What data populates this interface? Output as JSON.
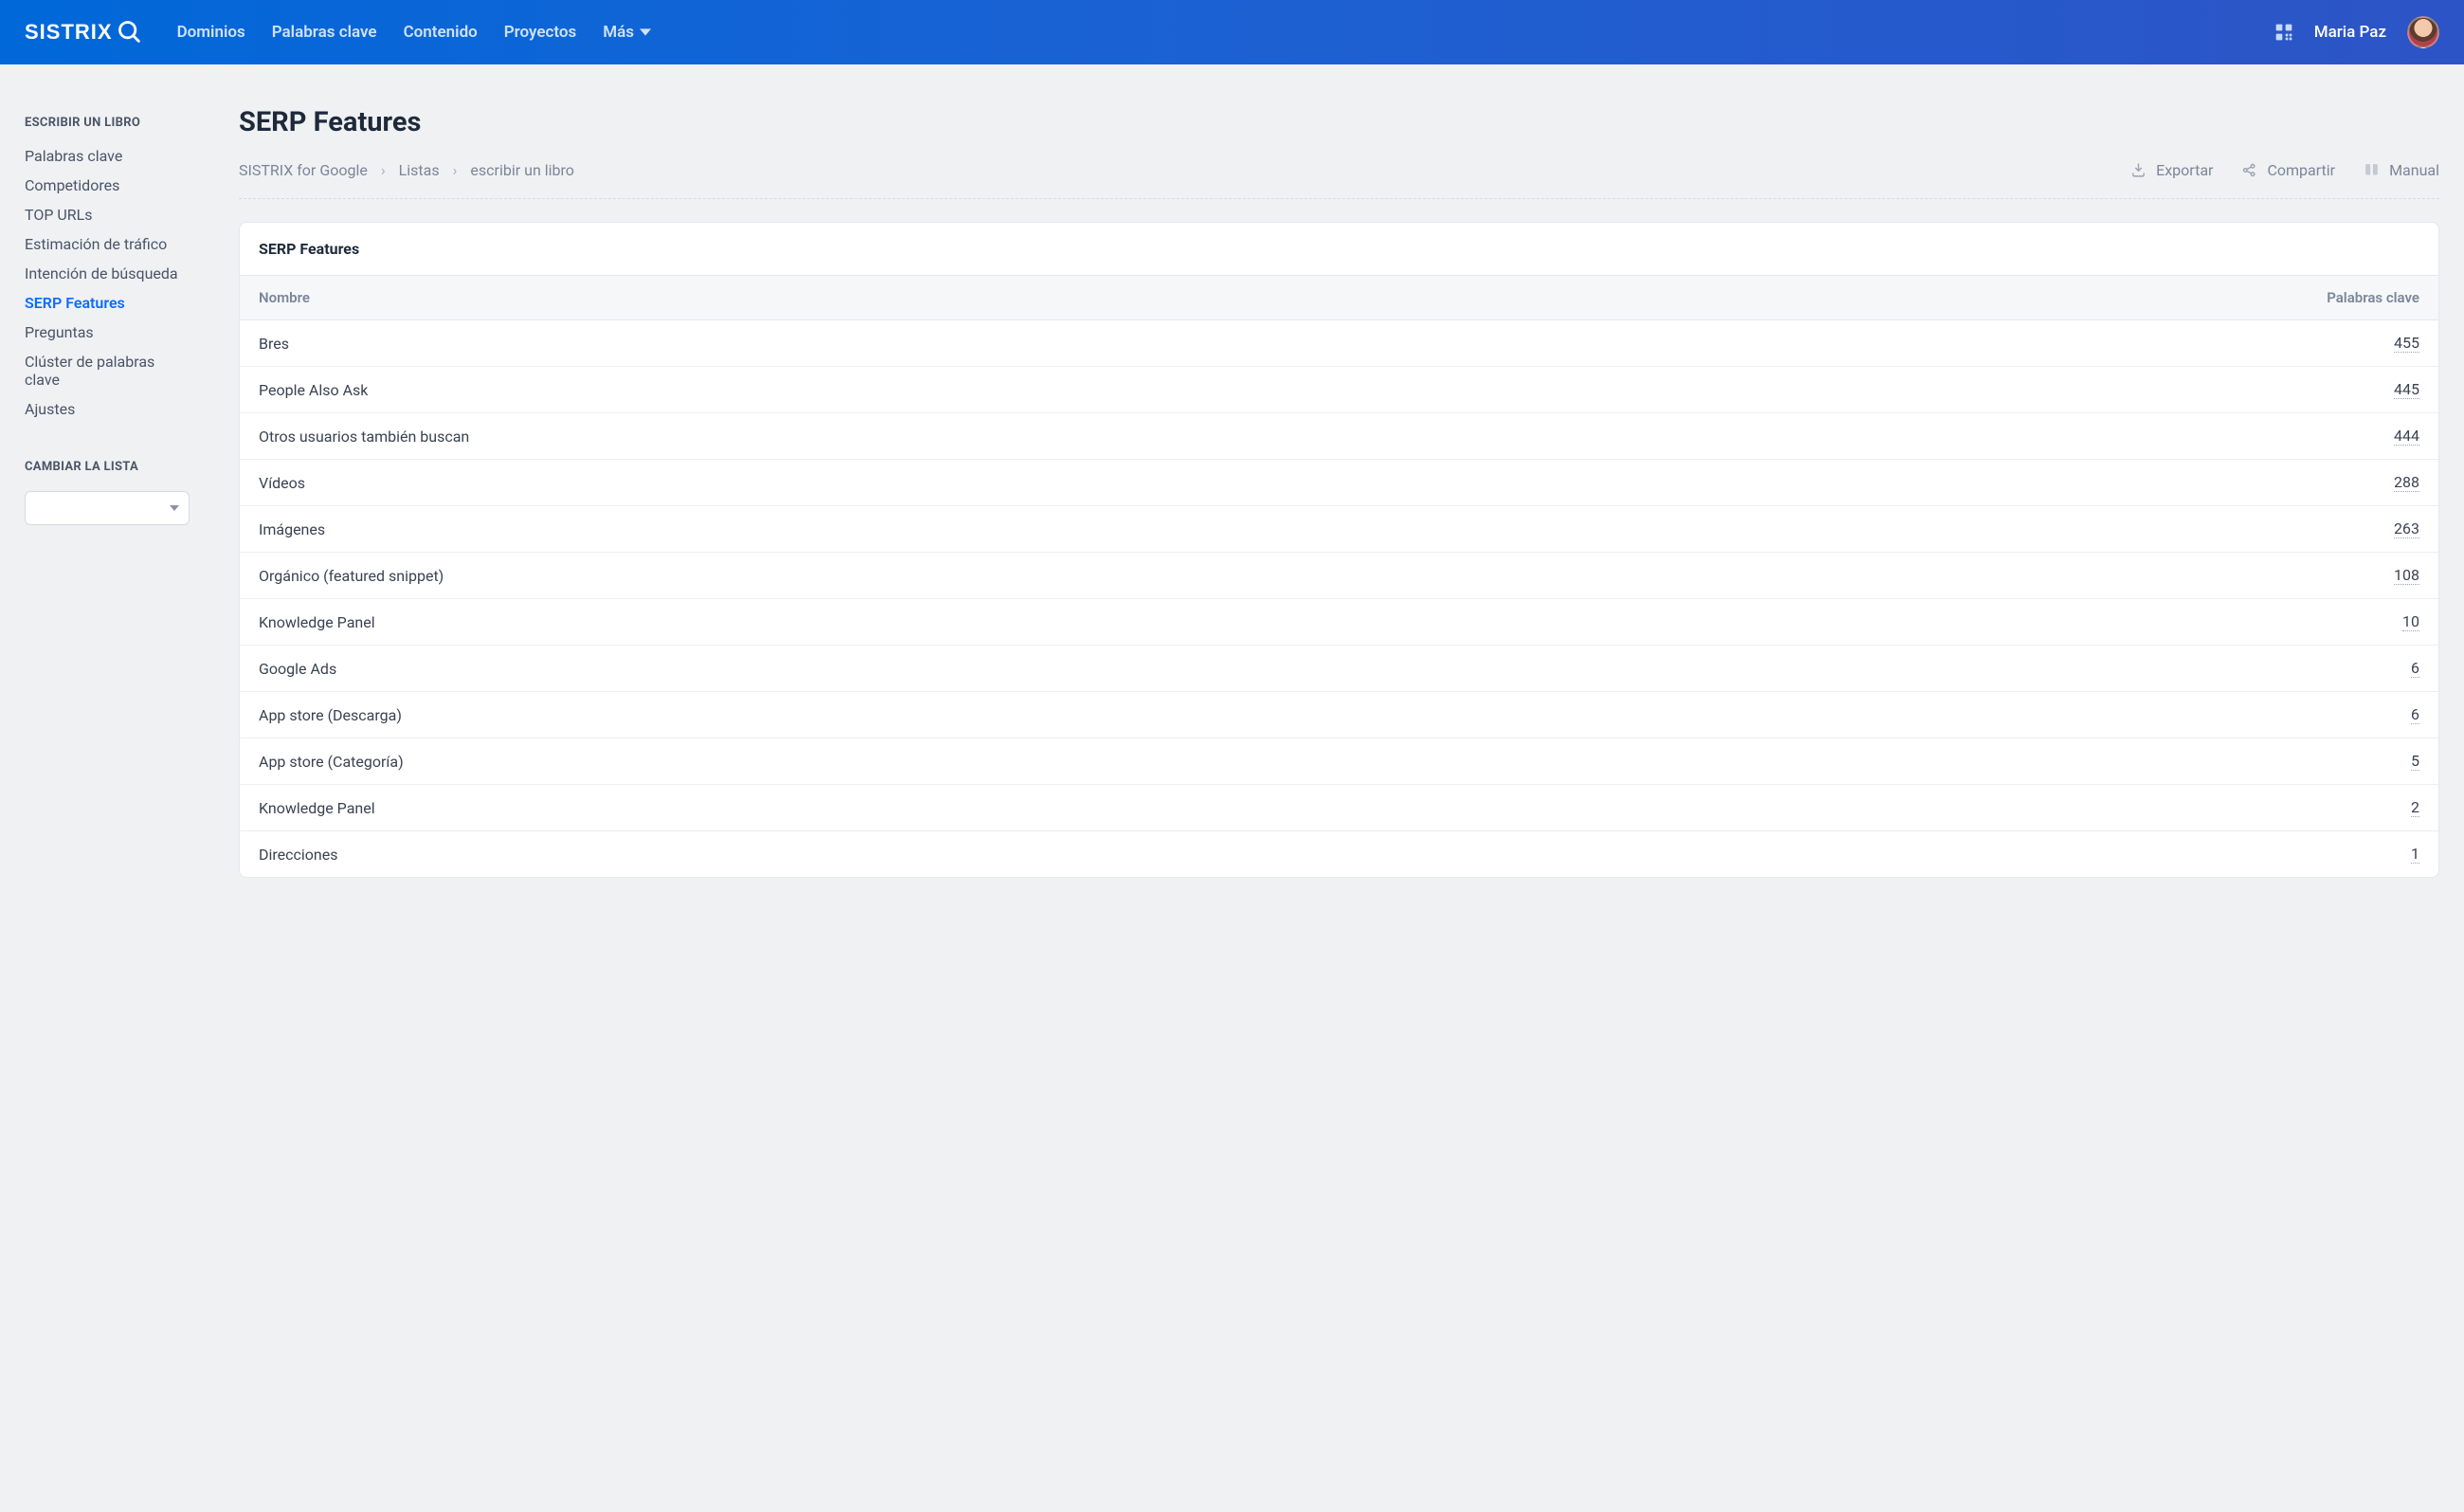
{
  "brand": "SISTRIX",
  "nav": {
    "items": [
      "Dominios",
      "Palabras clave",
      "Contenido",
      "Proyectos"
    ],
    "more_label": "Más"
  },
  "user": {
    "name": "Maria Paz"
  },
  "sidebar": {
    "heading": "ESCRIBIR UN LIBRO",
    "items": [
      {
        "label": "Palabras clave",
        "active": false
      },
      {
        "label": "Competidores",
        "active": false
      },
      {
        "label": "TOP URLs",
        "active": false
      },
      {
        "label": "Estimación de tráfico",
        "active": false
      },
      {
        "label": "Intención de búsqueda",
        "active": false
      },
      {
        "label": "SERP Features",
        "active": true
      },
      {
        "label": "Preguntas",
        "active": false
      },
      {
        "label": "Clúster de palabras clave",
        "active": false
      },
      {
        "label": "Ajustes",
        "active": false
      }
    ],
    "change_list_heading": "CAMBIAR LA LISTA"
  },
  "page": {
    "title": "SERP Features",
    "breadcrumb": [
      "SISTRIX for Google",
      "Listas",
      "escribir un libro"
    ],
    "actions": {
      "export": "Exportar",
      "share": "Compartir",
      "manual": "Manual"
    }
  },
  "table": {
    "title": "SERP Features",
    "columns": {
      "name": "Nombre",
      "count": "Palabras clave"
    },
    "rows": [
      {
        "name": "Bres",
        "count": "455"
      },
      {
        "name": "People Also Ask",
        "count": "445"
      },
      {
        "name": "Otros usuarios también buscan",
        "count": "444"
      },
      {
        "name": "Vídeos",
        "count": "288"
      },
      {
        "name": "Imágenes",
        "count": "263"
      },
      {
        "name": "Orgánico (featured snippet)",
        "count": "108"
      },
      {
        "name": "Knowledge Panel",
        "count": "10"
      },
      {
        "name": "Google Ads",
        "count": "6"
      },
      {
        "name": "App store (Descarga)",
        "count": "6"
      },
      {
        "name": "App store (Categoría)",
        "count": "5"
      },
      {
        "name": "Knowledge Panel",
        "count": "2"
      },
      {
        "name": "Direcciones",
        "count": "1"
      }
    ]
  }
}
